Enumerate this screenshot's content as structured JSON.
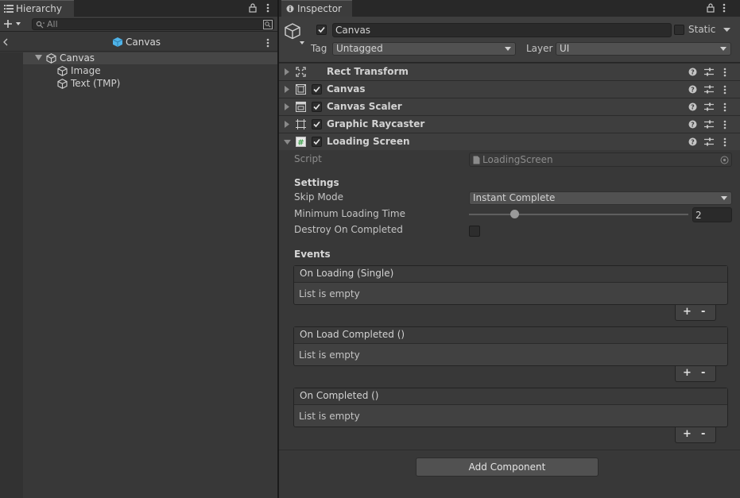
{
  "hierarchy": {
    "tab_label": "Hierarchy",
    "search_placeholder": "All",
    "scene_title": "Canvas",
    "tree": [
      {
        "label": "Canvas",
        "depth": 0,
        "expanded": true,
        "selected": true
      },
      {
        "label": "Image",
        "depth": 1
      },
      {
        "label": "Text (TMP)",
        "depth": 1
      }
    ]
  },
  "inspector": {
    "tab_label": "Inspector",
    "object": {
      "active": true,
      "name": "Canvas",
      "static_label": "Static",
      "tag_label": "Tag",
      "tag_value": "Untagged",
      "layer_label": "Layer",
      "layer_value": "UI"
    },
    "components": [
      {
        "name": "Rect Transform",
        "has_checkbox": false,
        "icon": "rect-transform-icon"
      },
      {
        "name": "Canvas",
        "has_checkbox": true,
        "icon": "canvas-icon"
      },
      {
        "name": "Canvas Scaler",
        "has_checkbox": true,
        "icon": "canvas-scaler-icon"
      },
      {
        "name": "Graphic Raycaster",
        "has_checkbox": true,
        "icon": "graphic-raycaster-icon"
      },
      {
        "name": "Loading Screen",
        "has_checkbox": true,
        "icon": "script-icon",
        "expanded": true
      }
    ],
    "loading_screen": {
      "script_label": "Script",
      "script_value": "LoadingScreen",
      "settings_header": "Settings",
      "skip_mode_label": "Skip Mode",
      "skip_mode_value": "Instant Complete",
      "min_time_label": "Minimum Loading Time",
      "min_time_value": "2",
      "min_time_slider_fraction": 0.21,
      "destroy_label": "Destroy On Completed",
      "destroy_checked": false,
      "events_header": "Events",
      "events": [
        {
          "title": "On Loading (Single)",
          "body": "List is empty"
        },
        {
          "title": "On Load Completed ()",
          "body": "List is empty"
        },
        {
          "title": "On Completed ()",
          "body": "List is empty"
        }
      ],
      "plus": "+",
      "minus": "-"
    },
    "add_component_label": "Add Component"
  },
  "colors": {
    "accent_cube": "#4fb3e8",
    "script_icon": "#3fa34d"
  }
}
